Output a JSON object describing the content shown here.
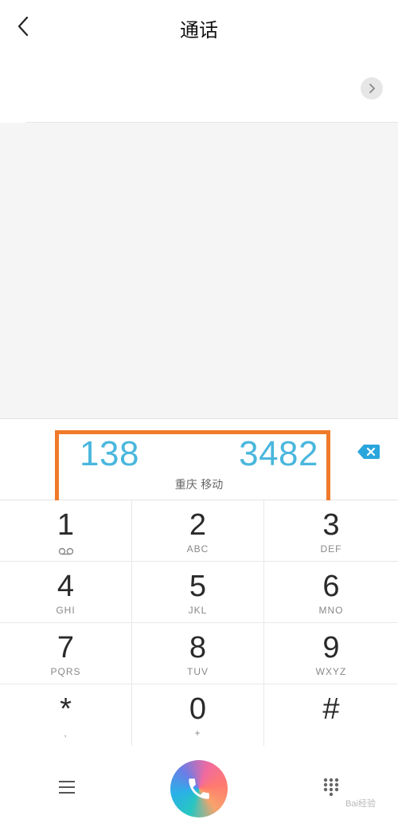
{
  "header": {
    "title": "通话"
  },
  "number": {
    "left": "138",
    "right": "3482",
    "location": "重庆 移动"
  },
  "keypad": {
    "keys": [
      {
        "digit": "1",
        "letters": ""
      },
      {
        "digit": "2",
        "letters": "ABC"
      },
      {
        "digit": "3",
        "letters": "DEF"
      },
      {
        "digit": "4",
        "letters": "GHI"
      },
      {
        "digit": "5",
        "letters": "JKL"
      },
      {
        "digit": "6",
        "letters": "MNO"
      },
      {
        "digit": "7",
        "letters": "PQRS"
      },
      {
        "digit": "8",
        "letters": "TUV"
      },
      {
        "digit": "9",
        "letters": "WXYZ"
      },
      {
        "digit": "*",
        "letters": ","
      },
      {
        "digit": "0",
        "letters": "+"
      },
      {
        "digit": "#",
        "letters": ""
      }
    ]
  },
  "bottom": {
    "watermark": "Bai经验"
  },
  "colors": {
    "accent": "#4ab7dd",
    "highlight": "#f07a2a"
  },
  "icons": {
    "back": "chevron-left-icon",
    "info": "chevron-right-icon",
    "delete": "backspace-icon",
    "voicemail": "voicemail-icon",
    "menu": "menu-icon",
    "call": "phone-icon",
    "dialpad": "dialpad-icon"
  }
}
